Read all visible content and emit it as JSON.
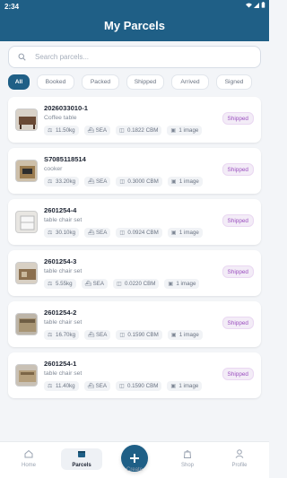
{
  "status_bar": {
    "time": "2:34"
  },
  "header": {
    "title": "My Parcels"
  },
  "search": {
    "placeholder": "Search parcels..."
  },
  "filters": [
    {
      "label": "All",
      "active": true
    },
    {
      "label": "Booked",
      "active": false
    },
    {
      "label": "Packed",
      "active": false
    },
    {
      "label": "Shipped",
      "active": false
    },
    {
      "label": "Arrived",
      "active": false
    },
    {
      "label": "Signed",
      "active": false
    }
  ],
  "parcels": [
    {
      "code": "2026033010-1",
      "desc": "Coffee table",
      "weight": "11.50kg",
      "mode": "SEA",
      "volume": "0.1822 CBM",
      "images": "1 image",
      "status": "Shipped"
    },
    {
      "code": "S7085118514",
      "desc": "cooker",
      "weight": "33.20kg",
      "mode": "SEA",
      "volume": "0.3000 CBM",
      "images": "1 image",
      "status": "Shipped"
    },
    {
      "code": "2601254-4",
      "desc": "table chair set",
      "weight": "30.10kg",
      "mode": "SEA",
      "volume": "0.0924 CBM",
      "images": "1 image",
      "status": "Shipped"
    },
    {
      "code": "2601254-3",
      "desc": "table chair set",
      "weight": "5.55kg",
      "mode": "SEA",
      "volume": "0.0220 CBM",
      "images": "1 image",
      "status": "Shipped"
    },
    {
      "code": "2601254-2",
      "desc": "table chair set",
      "weight": "16.70kg",
      "mode": "SEA",
      "volume": "0.1590 CBM",
      "images": "1 image",
      "status": "Shipped"
    },
    {
      "code": "2601254-1",
      "desc": "table chair set",
      "weight": "11.40kg",
      "mode": "SEA",
      "volume": "0.1590 CBM",
      "images": "1 image",
      "status": "Shipped"
    }
  ],
  "nav": {
    "home": "Home",
    "parcels": "Parcels",
    "create": "Create",
    "shop": "Shop",
    "profile": "Profile"
  },
  "colors": {
    "primary": "#1f5f86",
    "badge_text": "#9b4fbf",
    "badge_bg": "#f3ecf7"
  }
}
